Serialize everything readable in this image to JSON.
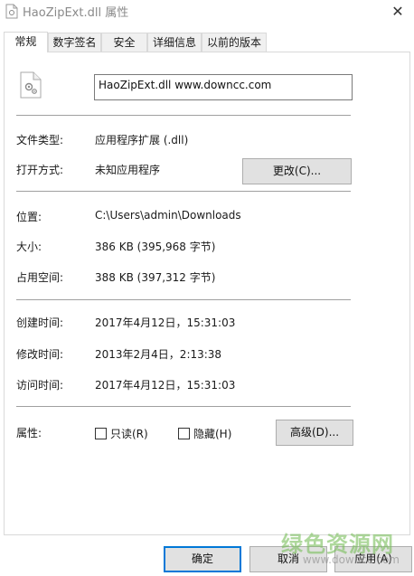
{
  "window": {
    "title": "HaoZipExt.dll 属性",
    "close_glyph": "✕"
  },
  "tabs": [
    {
      "label": "常规",
      "active": true
    },
    {
      "label": "数字签名",
      "active": false
    },
    {
      "label": "安全",
      "active": false
    },
    {
      "label": "详细信息",
      "active": false
    },
    {
      "label": "以前的版本",
      "active": false
    }
  ],
  "general": {
    "file_icon": "dll-gear-file-icon",
    "file_name": "HaoZipExt.dll      www.downcc.com",
    "file_type_label": "文件类型:",
    "file_type_value": "应用程序扩展 (.dll)",
    "open_with_label": "打开方式:",
    "open_with_value": "未知应用程序",
    "change_button": "更改(C)...",
    "location_label": "位置:",
    "location_value": "C:\\Users\\admin\\Downloads",
    "size_label": "大小:",
    "size_value": "386 KB (395,968 字节)",
    "size_on_disk_label": "占用空间:",
    "size_on_disk_value": "388 KB (397,312 字节)",
    "created_label": "创建时间:",
    "created_value": "2017年4月12日，15:31:03",
    "modified_label": "修改时间:",
    "modified_value": "2013年2月4日，2:13:38",
    "accessed_label": "访问时间:",
    "accessed_value": "2017年4月12日，15:31:03",
    "attributes_label": "属性:",
    "readonly_label": "只读(R)",
    "readonly_checked": false,
    "hidden_label": "隐藏(H)",
    "hidden_checked": false,
    "advanced_button": "高级(D)..."
  },
  "footer": {
    "ok_button": "确定",
    "cancel_button": "取消",
    "apply_button": "应用(A)"
  },
  "watermark": {
    "text": "绿色资源网",
    "url": "www.downcc.com"
  },
  "colors": {
    "accent_border": "#0078d7",
    "watermark_green": "#78be5a"
  }
}
